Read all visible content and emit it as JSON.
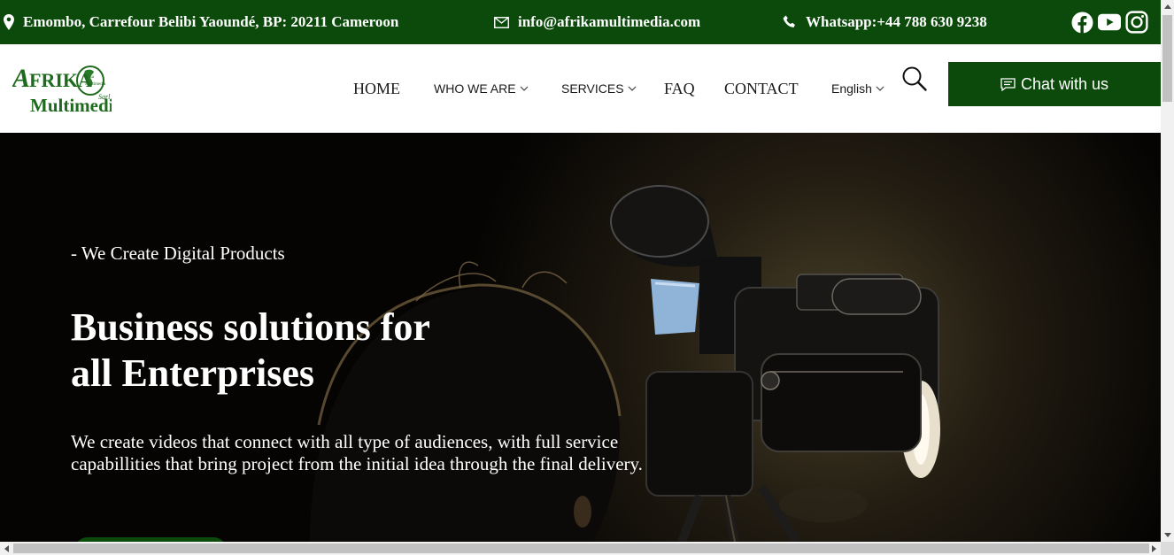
{
  "topbar": {
    "address": "Emombo, Carrefour Belibi Yaoundé, BP: 20211 Cameroon",
    "email": "info@afrikamultimedia.com",
    "whatsapp": "Whatsapp:+44 788 630 9238",
    "social_icons": [
      "facebook-icon",
      "youtube-icon",
      "instagram-icon"
    ],
    "bg_color": "#0b4a0b"
  },
  "logo": {
    "line1": "AFRIKA",
    "line2": "Multimedia",
    "suffix": "Sarl",
    "globe_text": "Afrika Multimedia"
  },
  "nav": {
    "home": "HOME",
    "who_we_are": "WHO WE ARE",
    "services": "SERVICES",
    "faq": "FAQ",
    "contact": "CONTACT",
    "language": "English",
    "chat_label": "Chat with us"
  },
  "hero": {
    "tagline": "- We Create Digital Products",
    "title_line1": "Business solutions for",
    "title_line2": "all Enterprises",
    "description": "We create videos that connect with all type of audiences, with full service capabillities that bring project from the initial idea through the final delivery."
  },
  "colors": {
    "brand_green": "#0b4a0b",
    "hero_bg": "#050403"
  }
}
